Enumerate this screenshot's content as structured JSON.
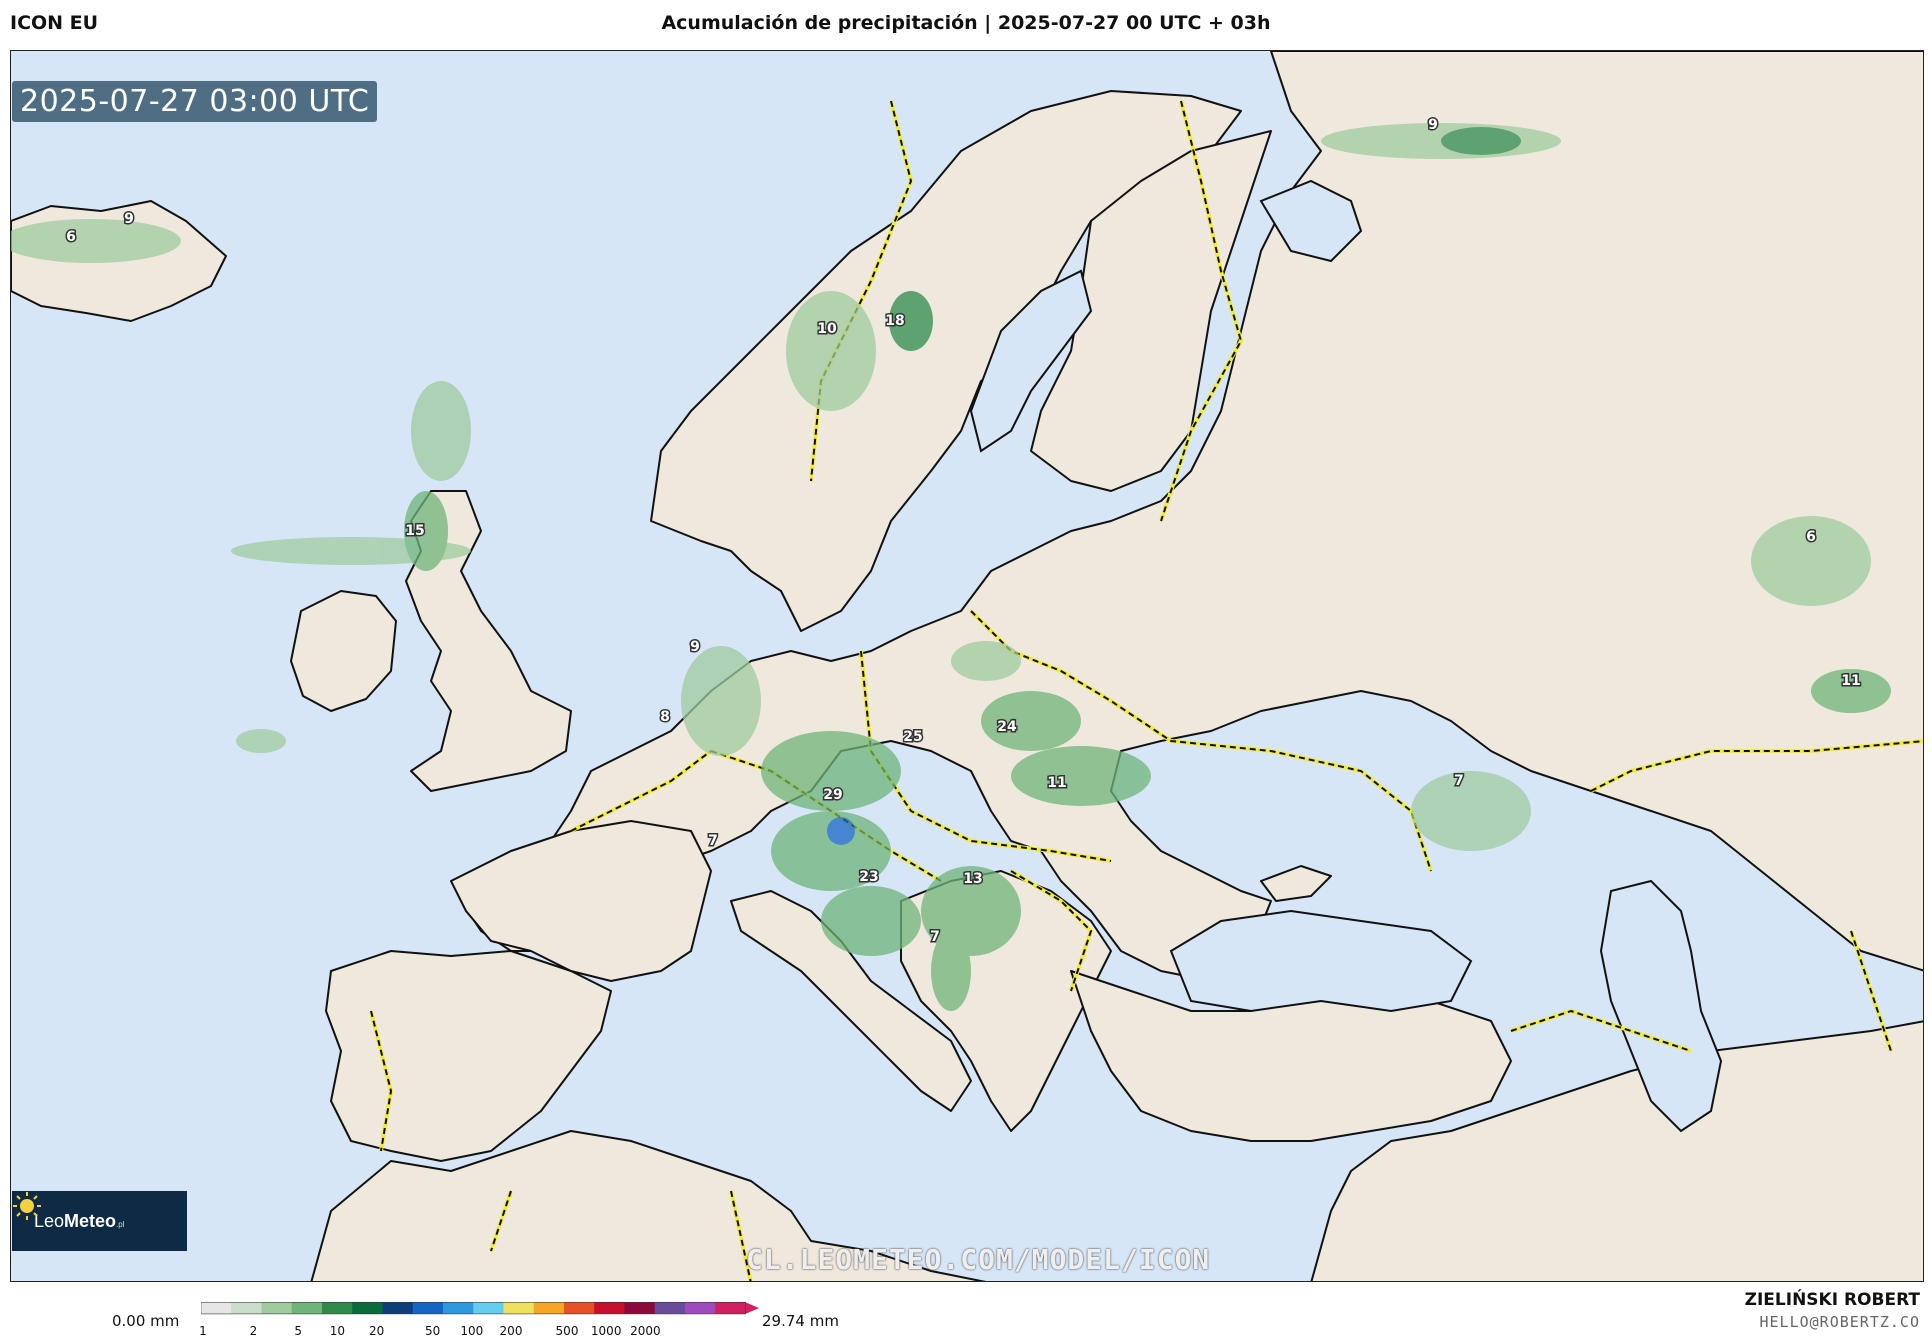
{
  "header": {
    "model": "ICON EU",
    "title": "Acumulación de precipitación | 2025-07-27 00 UTC + 03h"
  },
  "map": {
    "timestamp": "2025-07-27 03:00 UTC",
    "watermark": "CL.LEOMETEO.COM/MODEL/ICON",
    "logo": {
      "name": "LeoMeteo",
      "part1": "Leo",
      "part2": "Meteo",
      "suffix": ".pl"
    },
    "colors": {
      "sea": "#d6e6f7",
      "land": "#efe8dc",
      "border": "#f2ea3c",
      "coast": "#111111"
    },
    "precip_labels": [
      {
        "value": "6"
      },
      {
        "value": "9"
      },
      {
        "value": "9"
      },
      {
        "value": "10"
      },
      {
        "value": "18"
      },
      {
        "value": "15"
      },
      {
        "value": "9"
      },
      {
        "value": "8"
      },
      {
        "value": "25"
      },
      {
        "value": "24"
      },
      {
        "value": "29"
      },
      {
        "value": "11"
      },
      {
        "value": "7"
      },
      {
        "value": "23"
      },
      {
        "value": "13"
      },
      {
        "value": "7"
      },
      {
        "value": "7"
      },
      {
        "value": "6"
      },
      {
        "value": "11"
      }
    ]
  },
  "legend": {
    "min_label": "0.00 mm",
    "max_label": "29.74 mm",
    "ticks": [
      "1",
      "2",
      "5",
      "10",
      "20",
      "50",
      "100",
      "200",
      "500",
      "1000",
      "2000"
    ],
    "colors": [
      "#e6e6e6",
      "#c9ddc9",
      "#9fcb9f",
      "#6fb47a",
      "#2e8b4c",
      "#0b6b3b",
      "#0d3d7a",
      "#1665c4",
      "#2d9ae0",
      "#66ccf0",
      "#f0e060",
      "#f5a623",
      "#e8502a",
      "#c8102e",
      "#8b0a3a",
      "#6b4b9b",
      "#a04ac0",
      "#d02060"
    ]
  },
  "author": {
    "name": "ZIELIŃSKI ROBERT",
    "email": "HELLO@ROBERTZ.CO"
  }
}
